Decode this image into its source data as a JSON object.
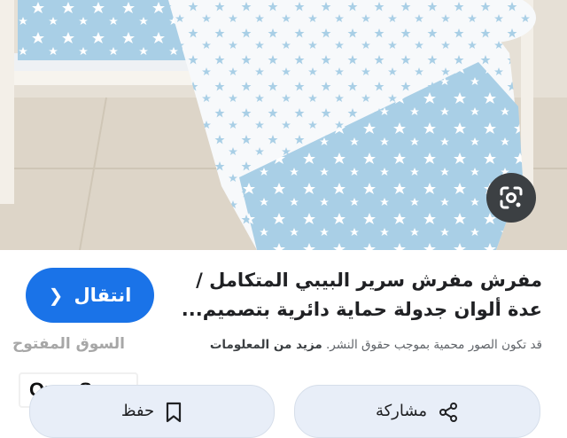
{
  "image": {
    "subject": "baby-crib-bedding-photo",
    "lens_icon": "google-lens-icon",
    "colors": {
      "fabric_blue": "#a9cfe6",
      "star": "#ffffff",
      "floor": "#e9e4dc"
    }
  },
  "visit_button": {
    "label": "انتقال",
    "icon": "chevron-right-icon"
  },
  "listing": {
    "title_line1": "مفرش مفرش سرير البيبي المتكامل /",
    "title_line2": "عدة ألوان جدولة حماية دائرية بتصميم...",
    "copyright_text": "قد تكون الصور محمية بموجب حقوق النشر.",
    "more_label": "مزيد من المعلومات",
    "watermark_text": "السوق المفتوح"
  },
  "brand": {
    "name": "OpenSooq"
  },
  "actions": {
    "save": {
      "label": "حفظ",
      "icon": "bookmark-icon"
    },
    "share": {
      "label": "مشاركة",
      "icon": "share-icon"
    }
  },
  "colors": {
    "accent": "#1a73e8",
    "action_bg": "#e8eef8",
    "text_primary": "#202124",
    "text_secondary": "#5f6368"
  }
}
